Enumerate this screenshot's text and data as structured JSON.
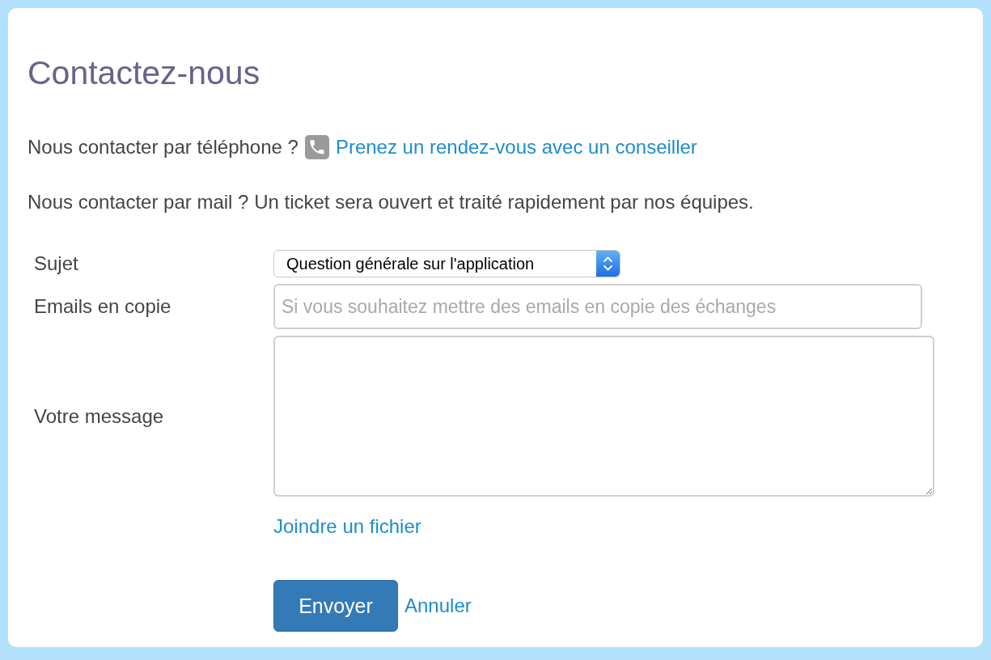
{
  "page": {
    "title": "Contactez-nous"
  },
  "phone_line": {
    "question": "Nous contacter par téléphone ?",
    "link": "Prenez un rendez-vous avec un conseiller"
  },
  "mail_line": {
    "text": "Nous contacter par mail ? Un ticket sera ouvert et traité rapidement par nos équipes."
  },
  "form": {
    "fields": [
      {
        "kind": "select",
        "label": "Sujet",
        "value": "Question générale sur l'application"
      },
      {
        "kind": "input",
        "label": "Emails en copie",
        "placeholder": "Si vous souhaitez mettre des emails en copie des échanges"
      },
      {
        "kind": "textarea",
        "label": "Votre message"
      }
    ],
    "attach_link": "Joindre un fichier",
    "buttons": [
      {
        "kind": "primary",
        "label": "Envoyer"
      },
      {
        "kind": "link",
        "label": "Annuler"
      }
    ]
  }
}
